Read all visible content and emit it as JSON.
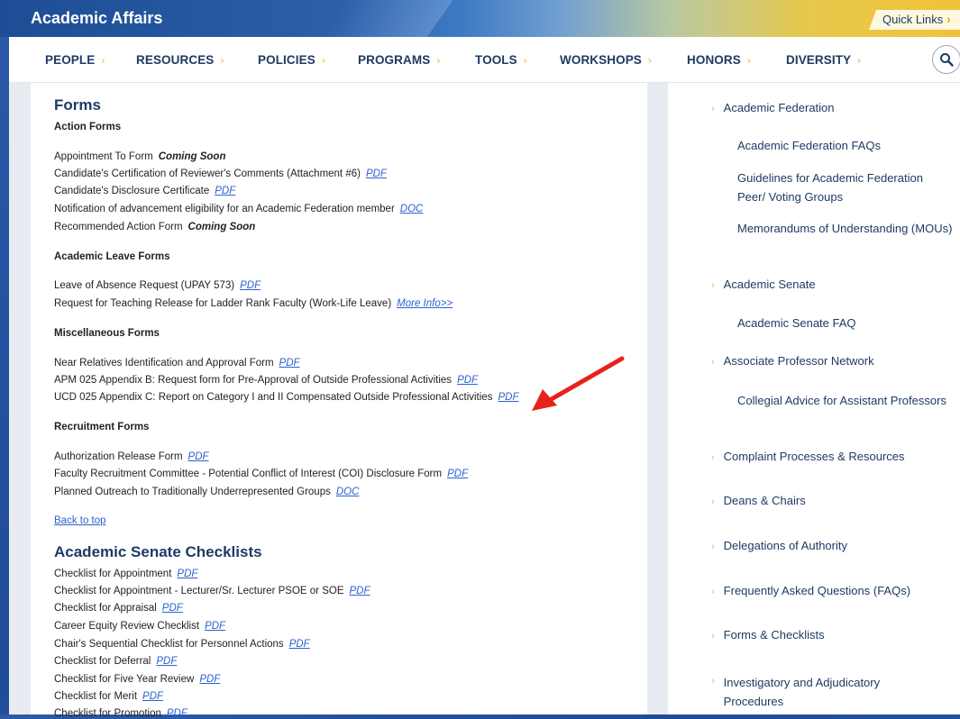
{
  "header": {
    "title": "Academic Affairs",
    "quick_links": "Quick Links"
  },
  "nav": {
    "items": [
      "PEOPLE",
      "RESOURCES",
      "POLICIES",
      "PROGRAMS",
      "TOOLS",
      "WORKSHOPS",
      "HONORS",
      "DIVERSITY"
    ]
  },
  "forms": {
    "title": "Forms",
    "action_forms": {
      "title": "Action Forms",
      "items": [
        {
          "text": "Appointment To Form",
          "suffix": "Coming Soon",
          "type": "soon"
        },
        {
          "text": "Candidate's Certification of Reviewer's Comments (Attachment #6)",
          "suffix": "PDF",
          "type": "link"
        },
        {
          "text": "Candidate's Disclosure Certificate",
          "suffix": "PDF",
          "type": "link"
        },
        {
          "text": "Notification of advancement eligibility for an Academic Federation member",
          "suffix": "DOC",
          "type": "link"
        },
        {
          "text": "Recommended Action Form",
          "suffix": "Coming Soon",
          "type": "soon"
        }
      ]
    },
    "academic_leave": {
      "title": "Academic Leave Forms",
      "items": [
        {
          "text": "Leave of Absence Request (UPAY 573)",
          "suffix": "PDF",
          "type": "link"
        },
        {
          "text": "Request for Teaching Release for Ladder Rank Faculty (Work-Life Leave)",
          "suffix": "More Info>>",
          "type": "more"
        }
      ]
    },
    "misc": {
      "title": "Miscellaneous Forms",
      "items": [
        {
          "text": "Near Relatives Identification and Approval Form",
          "suffix": "PDF",
          "type": "link"
        },
        {
          "text": "APM 025 Appendix B: Request form for Pre-Approval of Outside Professional Activities",
          "suffix": "PDF",
          "type": "link"
        },
        {
          "text": "UCD 025 Appendix C: Report on Category I and II Compensated Outside Professional Activities",
          "suffix": "PDF",
          "type": "link"
        }
      ]
    },
    "recruitment": {
      "title": "Recruitment Forms",
      "items": [
        {
          "text": "Authorization Release Form",
          "suffix": "PDF",
          "type": "link"
        },
        {
          "text": "Faculty Recruitment Committee - Potential Conflict of Interest (COI) Disclosure Form",
          "suffix": "PDF",
          "type": "link"
        },
        {
          "text": "Planned Outreach to Traditionally Underrepresented Groups",
          "suffix": "DOC",
          "type": "link"
        }
      ]
    },
    "back_to_top": "Back to top"
  },
  "checklists": {
    "title": "Academic Senate Checklists",
    "items": [
      {
        "text": "Checklist for Appointment",
        "suffix": "PDF"
      },
      {
        "text": "Checklist for Appointment - Lecturer/Sr. Lecturer PSOE or SOE",
        "suffix": "PDF"
      },
      {
        "text": "Checklist for Appraisal",
        "suffix": "PDF"
      },
      {
        "text": "Career Equity Review Checklist",
        "suffix": "PDF"
      },
      {
        "text": "Chair's Sequential Checklist for Personnel Actions",
        "suffix": "PDF"
      },
      {
        "text": "Checklist for Deferral",
        "suffix": "PDF"
      },
      {
        "text": "Checklist for Five Year Review",
        "suffix": "PDF"
      },
      {
        "text": "Checklist for Merit",
        "suffix": "PDF"
      },
      {
        "text": "Checklist for Promotion",
        "suffix": "PDF"
      }
    ]
  },
  "sidebar": {
    "items": [
      {
        "label": "Academic Federation",
        "level": 1
      },
      {
        "label": "Academic Federation FAQs",
        "level": 2
      },
      {
        "label": "Guidelines for Academic Federation Peer/ Voting Groups",
        "level": 2
      },
      {
        "label": "Memorandums of Understanding (MOUs)",
        "level": 2
      },
      {
        "label": "Academic Senate",
        "level": 1
      },
      {
        "label": "Academic Senate FAQ",
        "level": 2
      },
      {
        "label": "Associate Professor Network",
        "level": 1
      },
      {
        "label": "Collegial Advice for Assistant Professors",
        "level": 2
      },
      {
        "label": "Complaint Processes & Resources",
        "level": 1
      },
      {
        "label": "Deans & Chairs",
        "level": 1
      },
      {
        "label": "Delegations of Authority",
        "level": 1
      },
      {
        "label": "Frequently Asked Questions (FAQs)",
        "level": 1
      },
      {
        "label": "Forms & Checklists",
        "level": 1
      },
      {
        "label": "Investigatory and Adjudicatory Procedures",
        "level": 1
      }
    ]
  },
  "colors": {
    "accent": "#2b62d0",
    "nav_text": "#1f3a64",
    "chevron": "#f0b74b",
    "arrow": "#e8211b"
  }
}
